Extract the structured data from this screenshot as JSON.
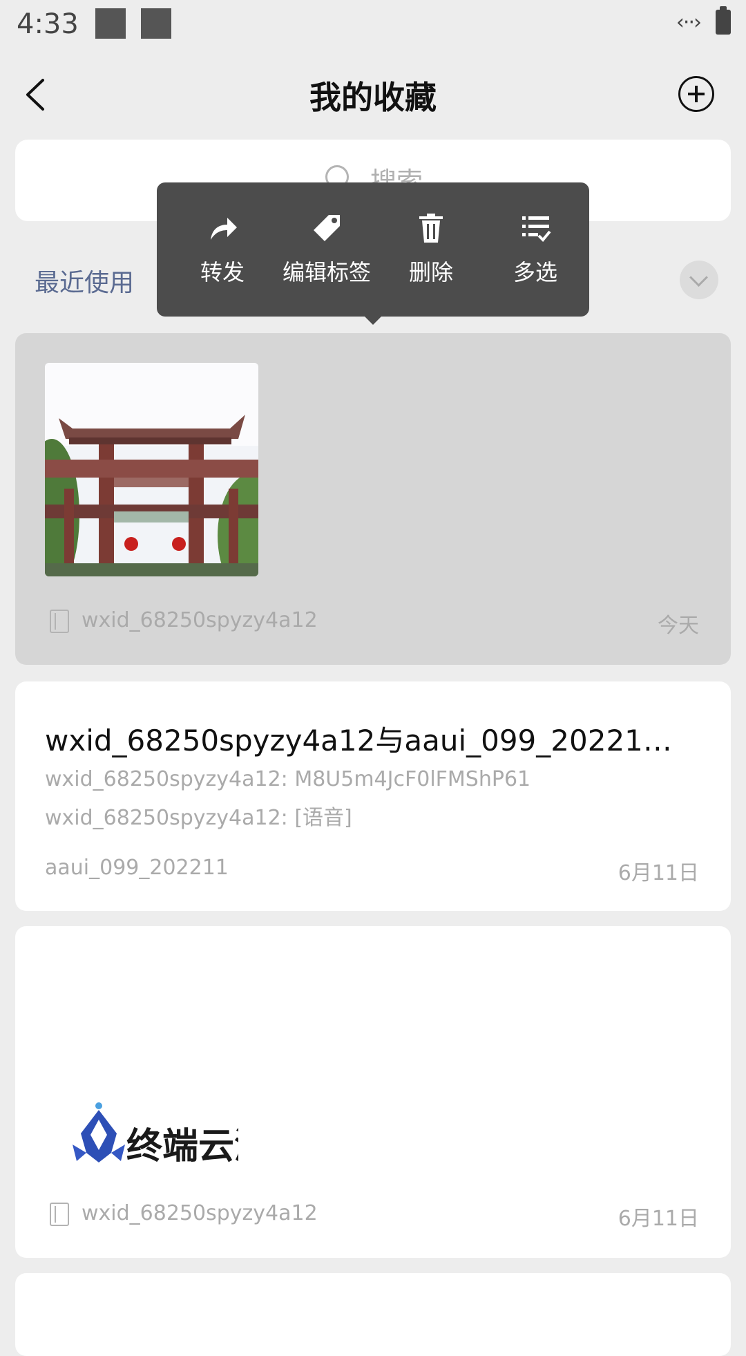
{
  "status_bar": {
    "time": "4:33",
    "nfc": "‹··›"
  },
  "header": {
    "title": "我的收藏"
  },
  "search": {
    "placeholder": "搜索"
  },
  "filter": {
    "recent_label": "最近使用"
  },
  "context_menu": {
    "items": [
      {
        "label": "转发",
        "icon": "share-arrow-icon"
      },
      {
        "label": "编辑标签",
        "icon": "tag-icon"
      },
      {
        "label": "删除",
        "icon": "trash-icon"
      },
      {
        "label": "多选",
        "icon": "multi-select-icon"
      }
    ]
  },
  "favorites": [
    {
      "type": "image",
      "source": "wxid_68250spyzy4a12",
      "date": "今天"
    },
    {
      "type": "chat_history",
      "title": "wxid_68250spyzy4a12与aaui_099_202211...",
      "lines": [
        "wxid_68250spyzy4a12: M8U5m4JcF0lFMShP61",
        "wxid_68250spyzy4a12: [语音]"
      ],
      "source": "aaui_099_202211",
      "date": "6月11日"
    },
    {
      "type": "image",
      "source": "wxid_68250spyzy4a12",
      "date": "6月11日",
      "logo_text": "终端云测"
    }
  ],
  "colors": {
    "accent_link": "#5a6a91",
    "menu_bg": "#4c4c4c",
    "selected_card": "#d6d6d6"
  }
}
